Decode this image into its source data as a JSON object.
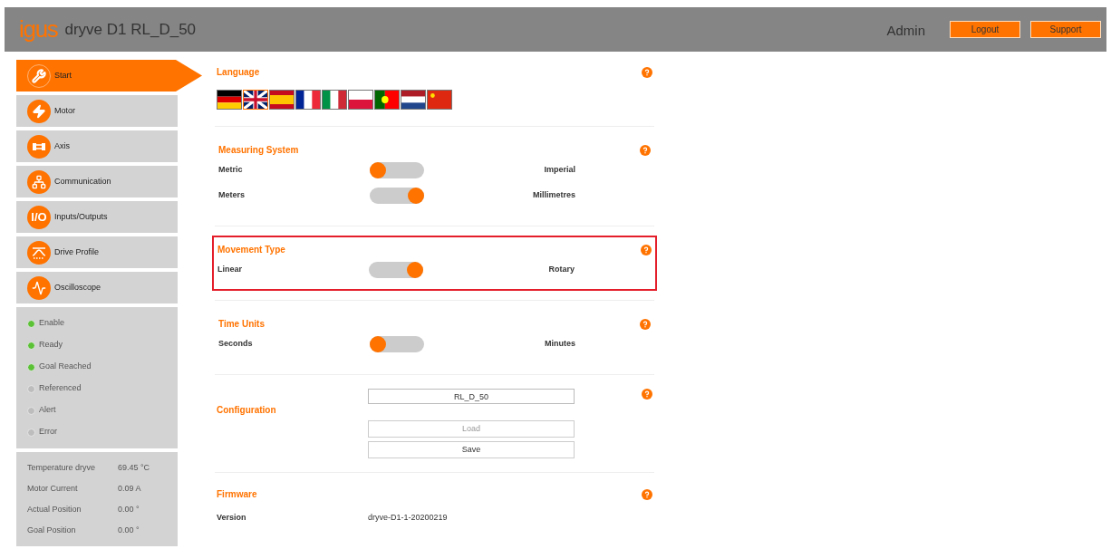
{
  "header": {
    "logo": "igus",
    "title": "dryve D1 RL_D_50",
    "user": "Admin",
    "buttons": [
      "Logout",
      "Support"
    ]
  },
  "nav": [
    {
      "label": "Start",
      "kind": "wrench",
      "selected": true
    },
    {
      "label": "Motor",
      "kind": "motor",
      "selected": false
    },
    {
      "label": "Axis",
      "kind": "axis",
      "selected": false
    },
    {
      "label": "Communication",
      "kind": "network",
      "selected": false
    },
    {
      "label": "Inputs/Outputs",
      "kind": "io",
      "icon_text": "I/O",
      "selected": false
    },
    {
      "label": "Drive Profile",
      "kind": "profile",
      "selected": false
    },
    {
      "label": "Oscilloscope",
      "kind": "wave",
      "selected": false
    }
  ],
  "status": [
    {
      "label": "Enable",
      "on": true
    },
    {
      "label": "Ready",
      "on": true
    },
    {
      "label": "Goal Reached",
      "on": true
    },
    {
      "label": "Referenced",
      "on": false
    },
    {
      "label": "Alert",
      "on": false
    },
    {
      "label": "Error",
      "on": false
    }
  ],
  "readings": [
    {
      "label": "Temperature dryve",
      "value": "69.45 °C"
    },
    {
      "label": "Motor Current",
      "value": "0.09 A"
    },
    {
      "label": "Actual Position",
      "value": "0.00 °"
    },
    {
      "label": "Goal Position",
      "value": "0.00 °"
    }
  ],
  "language": {
    "title": "Language",
    "flags": [
      {
        "kind": "de",
        "selected": false
      },
      {
        "kind": "gb",
        "selected": true
      },
      {
        "kind": "es",
        "selected": false
      },
      {
        "kind": "fr",
        "selected": false
      },
      {
        "kind": "it",
        "selected": false
      },
      {
        "kind": "pl",
        "selected": false
      },
      {
        "kind": "pt",
        "selected": false
      },
      {
        "kind": "nl",
        "selected": false
      },
      {
        "kind": "cn",
        "selected": false
      }
    ]
  },
  "toggle_sections": [
    {
      "title": "Measuring System",
      "highlighted": false,
      "rows": [
        {
          "left": "Metric",
          "right": "Imperial",
          "on": false
        },
        {
          "left": "Meters",
          "right": "Millimetres",
          "on": true
        }
      ]
    },
    {
      "title": "Movement Type",
      "highlighted": true,
      "rows": [
        {
          "left": "Linear",
          "right": "Rotary",
          "on": true
        }
      ]
    },
    {
      "title": "Time Units",
      "highlighted": false,
      "rows": [
        {
          "left": "Seconds",
          "right": "Minutes",
          "on": false
        }
      ]
    }
  ],
  "configuration": {
    "title": "Configuration",
    "value": "RL_D_50",
    "buttons": [
      {
        "label": "Load",
        "disabled": true
      },
      {
        "label": "Save",
        "disabled": false
      }
    ]
  },
  "firmware": {
    "title": "Firmware",
    "label": "Version",
    "value": "dryve-D1-1-20200219"
  }
}
